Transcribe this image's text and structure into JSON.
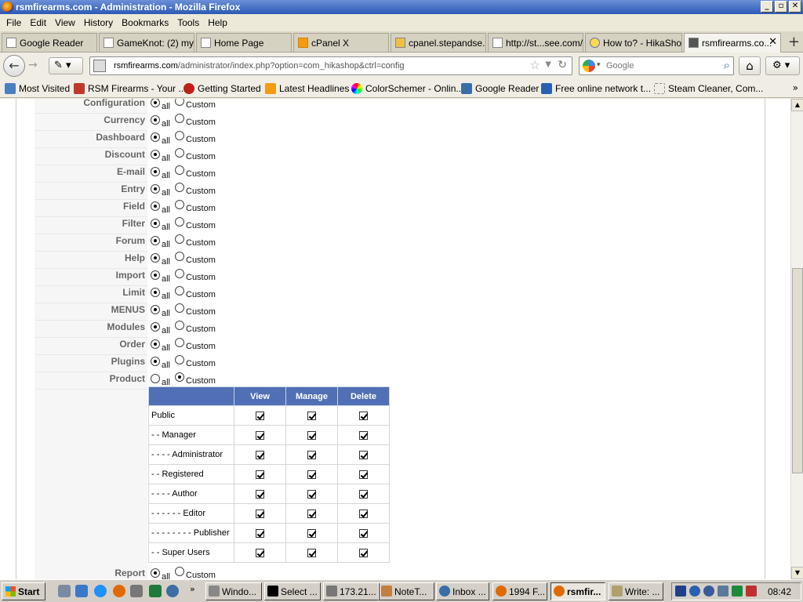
{
  "window": {
    "title": "rsmfirearms.com - Administration - Mozilla Firefox",
    "min": "_",
    "max": "▫",
    "close": "✕"
  },
  "menu": [
    "File",
    "Edit",
    "View",
    "History",
    "Bookmarks",
    "Tools",
    "Help"
  ],
  "tabs": [
    {
      "label": "Google Reader"
    },
    {
      "label": "GameKnot: (2) my..."
    },
    {
      "label": "Home Page"
    },
    {
      "label": "cPanel X"
    },
    {
      "label": "cpanel.stepandse..."
    },
    {
      "label": "http://st...see.com/"
    },
    {
      "label": "How to? - HikaShop"
    },
    {
      "label": "rsmfirearms.co..."
    }
  ],
  "nav": {
    "url_domain": "rsmfirearms.com",
    "url_path": "/administrator/index.php?option=com_hikashop&ctrl=config",
    "search_placeholder": "Google"
  },
  "bookmarks": [
    {
      "label": "Most Visited"
    },
    {
      "label": "RSM Firearms - Your ..."
    },
    {
      "label": "Getting Started"
    },
    {
      "label": "Latest Headlines"
    },
    {
      "label": "ColorSchemer - Onlin..."
    },
    {
      "label": "Google Reader"
    },
    {
      "label": "Free online network t..."
    },
    {
      "label": "Steam Cleaner, Com..."
    }
  ],
  "acl": {
    "all_label": "all",
    "custom_label": "Custom",
    "rows": [
      {
        "label": "Configuration",
        "value": "all"
      },
      {
        "label": "Currency",
        "value": "all"
      },
      {
        "label": "Dashboard",
        "value": "all"
      },
      {
        "label": "Discount",
        "value": "all"
      },
      {
        "label": "E-mail",
        "value": "all"
      },
      {
        "label": "Entry",
        "value": "all"
      },
      {
        "label": "Field",
        "value": "all"
      },
      {
        "label": "Filter",
        "value": "all"
      },
      {
        "label": "Forum",
        "value": "all"
      },
      {
        "label": "Help",
        "value": "all"
      },
      {
        "label": "Import",
        "value": "all"
      },
      {
        "label": "Limit",
        "value": "all"
      },
      {
        "label": "MENUS",
        "value": "all"
      },
      {
        "label": "Modules",
        "value": "all"
      },
      {
        "label": "Order",
        "value": "all"
      },
      {
        "label": "Plugins",
        "value": "all"
      },
      {
        "label": "Product",
        "value": "custom"
      },
      {
        "label": "Report",
        "value": "all"
      }
    ],
    "product_table": {
      "headers": [
        "View",
        "Manage",
        "Delete"
      ],
      "groups": [
        {
          "name": "Public",
          "view": true,
          "manage": true,
          "delete": true
        },
        {
          "name": "- - Manager",
          "view": true,
          "manage": true,
          "delete": true
        },
        {
          "name": "- - - - Administrator",
          "view": true,
          "manage": true,
          "delete": true
        },
        {
          "name": "- - Registered",
          "view": true,
          "manage": true,
          "delete": true
        },
        {
          "name": "- - - - Author",
          "view": true,
          "manage": true,
          "delete": true
        },
        {
          "name": "- - - - - - Editor",
          "view": true,
          "manage": true,
          "delete": true
        },
        {
          "name": "- - - - - - - - Publisher",
          "view": true,
          "manage": true,
          "delete": true
        },
        {
          "name": "- - Super Users",
          "view": true,
          "manage": true,
          "delete": true
        }
      ]
    }
  },
  "taskbar": {
    "start": "Start",
    "more": "»",
    "items": [
      {
        "label": "Windo..."
      },
      {
        "label": "Select ..."
      },
      {
        "label": "173.21..."
      },
      {
        "label": "NoteT..."
      },
      {
        "label": "Inbox ..."
      },
      {
        "label": "1994 F..."
      },
      {
        "label": "rsmfir..."
      },
      {
        "label": "Write: ..."
      }
    ],
    "clock": "08:42"
  },
  "colors": {
    "table_header": "#516fb5",
    "titlebar": "#2c5ab5"
  }
}
